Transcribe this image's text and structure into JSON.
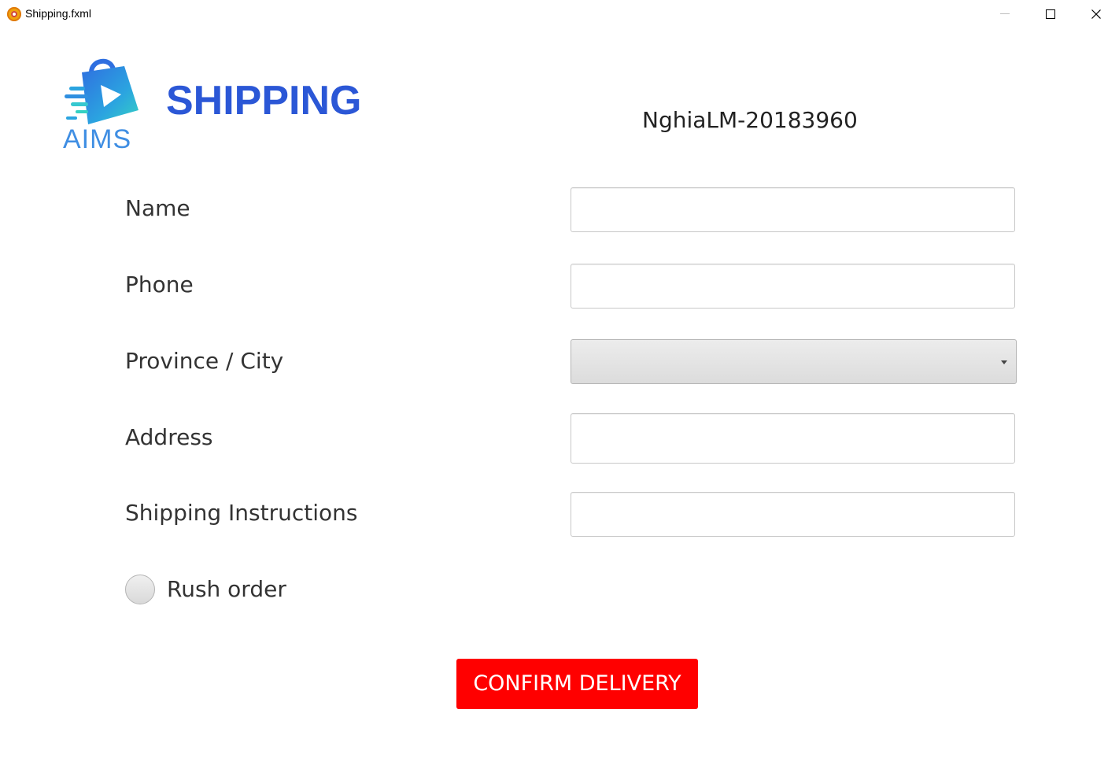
{
  "window": {
    "title": "Shipping.fxml"
  },
  "header": {
    "logo_text": "AIMS",
    "title": "SHIPPING",
    "student_id": "NghiaLM-20183960"
  },
  "form": {
    "name": {
      "label": "Name",
      "value": ""
    },
    "phone": {
      "label": "Phone",
      "value": ""
    },
    "province": {
      "label": "Province / City",
      "selected": ""
    },
    "address": {
      "label": "Address",
      "value": ""
    },
    "instructions": {
      "label": "Shipping Instructions",
      "value": ""
    },
    "rush_order": {
      "label": "Rush order",
      "checked": false
    }
  },
  "actions": {
    "confirm_label": "CONFIRM DELIVERY"
  },
  "colors": {
    "title_blue": "#2b57d6",
    "logo_blue": "#3f8ee3",
    "logo_teal": "#35d1c3",
    "confirm_red": "#ff0000"
  },
  "icons": {
    "app": "app-icon",
    "logo": "shopping-bag-play-logo",
    "minimize": "minimize-icon",
    "maximize": "maximize-icon",
    "close": "close-icon",
    "dropdown": "chevron-down-icon"
  }
}
